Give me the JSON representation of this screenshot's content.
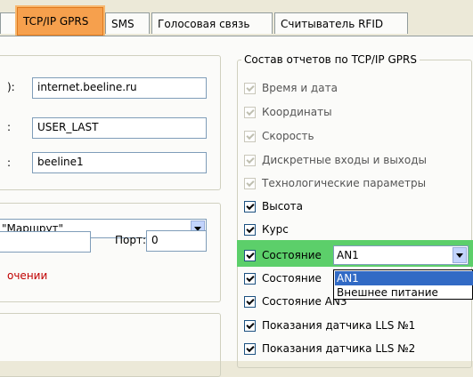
{
  "tabs": [
    {
      "label": "TCP/IP GPRS",
      "active": true
    },
    {
      "label": "SMS"
    },
    {
      "label": "Голосовая связь"
    },
    {
      "label": "Считыватель RFID"
    }
  ],
  "left": {
    "fields": [
      {
        "label": "):",
        "value": "internet.beeline.ru"
      },
      {
        "label": ":",
        "value": "USER_LAST"
      },
      {
        "label": ":",
        "value": "beeline1"
      }
    ],
    "route_combo": "\"Маршрут\"",
    "port_label": "Порт:",
    "port_value": "0",
    "error_text": "очении"
  },
  "reports": {
    "title": "Состав отчетов по TCP/IP GPRS",
    "items": [
      {
        "label": "Время и дата",
        "checked": true,
        "disabled": true
      },
      {
        "label": "Координаты",
        "checked": true,
        "disabled": true
      },
      {
        "label": "Скорость",
        "checked": true,
        "disabled": true
      },
      {
        "label": "Дискретные входы и выходы",
        "checked": true,
        "disabled": true
      },
      {
        "label": "Технологические параметры",
        "checked": true,
        "disabled": true
      },
      {
        "label": "Высота",
        "checked": true,
        "disabled": false
      },
      {
        "label": "Курс",
        "checked": true,
        "disabled": false
      },
      {
        "label": "Состояние",
        "checked": true,
        "disabled": false
      },
      {
        "label": "Состояние",
        "checked": true,
        "disabled": false
      },
      {
        "label": "Состояние AN3",
        "checked": true,
        "disabled": false
      },
      {
        "label": "Показания датчика LLS №1",
        "checked": true,
        "disabled": false
      },
      {
        "label": "Показания датчика LLS №2",
        "checked": true,
        "disabled": false
      }
    ],
    "combo_value": "AN1",
    "dropdown_options": [
      "AN1",
      "Внешнее питание"
    ],
    "highlight_color": "#5ccf6a"
  }
}
